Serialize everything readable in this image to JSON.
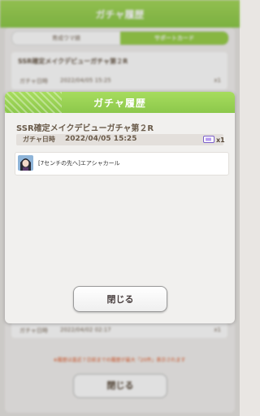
{
  "background": {
    "header_title": "ガチャ履歴",
    "tabs": [
      "育成ウマ娘",
      "サポートカード"
    ],
    "items": [
      {
        "name": "SSR確定メイクデビューガチャ第２R",
        "date_label": "ガチャ日時",
        "date": "2022/04/05 15:25",
        "count": "x1"
      },
      {
        "name": "",
        "date_label": "ガチャ日時",
        "date": "2022/04/02 02:17",
        "count": "x1"
      }
    ],
    "note": "※履歴は直近７日前までの履歴が最大『20件』表示されます",
    "close_label": "閉じる"
  },
  "dialog": {
    "title": "ガチャ履歴",
    "gacha_name": "SSR確定メイクデビューガチャ第２R",
    "date_label": "ガチャ日時",
    "date_value": "2022/04/05 15:25",
    "ticket_icon": "ticket-icon",
    "ticket_count": "x1",
    "results": [
      {
        "text": "[7センチの先へ]エアシャカール",
        "avatar_icon": "character-portrait"
      }
    ],
    "close_label": "閉じる"
  },
  "colors": {
    "header_green": "#9ad04c",
    "text_brown": "#6a5b4a",
    "note_red": "#e25a2a"
  }
}
